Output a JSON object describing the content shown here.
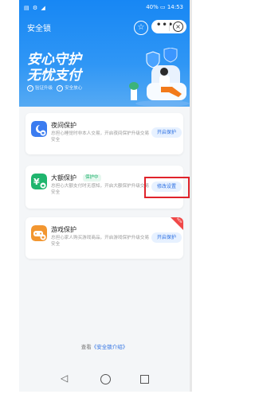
{
  "status": {
    "left": "▤ ⚙ ◢",
    "right": "40% ▭ 14:53"
  },
  "header": {
    "title": "安全锁",
    "star_icon": "star-icon",
    "more_glyph": "•••",
    "close_glyph": "⊗"
  },
  "hero": {
    "slogan_line1": "安心守护",
    "slogan_line2": "无忧支付",
    "features": [
      "验证升级",
      "安全放心"
    ]
  },
  "cards": [
    {
      "title": "夜间保护",
      "desc": "总担心睡觉时非本人交易，开启夜间保护升级交易安全",
      "button": "开启保护",
      "badge": "",
      "icon": "moon-lock-icon",
      "icon_color": "#3b7cf0"
    },
    {
      "title": "大额保护",
      "desc": "总担心大额支付时无感知，开启大额保护升级交易安全",
      "button": "修改设置",
      "badge": "保护中",
      "icon": "yen-lock-icon",
      "icon_color": "#1fb56e"
    },
    {
      "title": "游戏保护",
      "desc": "总担心家人购买游戏商品，开启游戏保护升级交易安全",
      "button": "开启保护",
      "badge": "",
      "icon": "gamepad-lock-icon",
      "icon_color": "#f29630",
      "ribbon": "NEW"
    }
  ],
  "footer": {
    "prefix": "查看",
    "link": "《安全锁介绍》"
  },
  "colors": {
    "primary": "#1787f4",
    "highlight": "#e0232b"
  }
}
